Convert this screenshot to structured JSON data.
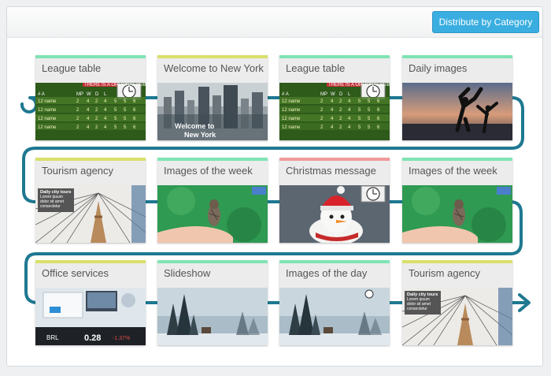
{
  "toolbar": {
    "distribute_label": "Distribute by Category"
  },
  "colors": {
    "track": "#1e7891",
    "button": "#3aaee0",
    "bar_green": "#7fe3b4",
    "bar_yellow": "#d9e06a",
    "bar_red": "#f1999b"
  },
  "playlist": {
    "items": [
      {
        "title": "League table",
        "bar": "green",
        "thumb": "league"
      },
      {
        "title": "Welcome to New York",
        "bar": "yellow",
        "thumb": "newyork"
      },
      {
        "title": "League table",
        "bar": "green",
        "thumb": "league"
      },
      {
        "title": "Daily images",
        "bar": "green",
        "thumb": "sunset"
      },
      {
        "title": "Tourism agency",
        "bar": "yellow",
        "thumb": "bridge"
      },
      {
        "title": "Images of the week",
        "bar": "green",
        "thumb": "bird"
      },
      {
        "title": "Christmas message",
        "bar": "red",
        "thumb": "snowman"
      },
      {
        "title": "Images of the week",
        "bar": "green",
        "thumb": "bird"
      },
      {
        "title": "Office services",
        "bar": "yellow",
        "thumb": "office"
      },
      {
        "title": "Slideshow",
        "bar": "green",
        "thumb": "forest"
      },
      {
        "title": "Images of the day",
        "bar": "green",
        "thumb": "forest"
      },
      {
        "title": "Tourism agency",
        "bar": "yellow",
        "thumb": "bridge"
      }
    ]
  },
  "league": {
    "header": [
      "#",
      "A",
      "MP",
      "W",
      "D",
      "L"
    ],
    "team": "12 name",
    "values": [
      "2",
      "4",
      "2",
      "4",
      "5",
      "5",
      "6"
    ],
    "banner": "THERE IS A OPTIONAL SUBTITLE"
  },
  "newyork": {
    "line1": "Welcome to",
    "line2": "New York"
  },
  "tourism": {
    "badge_title": "Daily city tours",
    "badge_text": "Lorem ipsum dolor sit amet consectetur"
  },
  "office": {
    "currency": "BRL",
    "value": "0.28",
    "change": "-1.37%"
  }
}
